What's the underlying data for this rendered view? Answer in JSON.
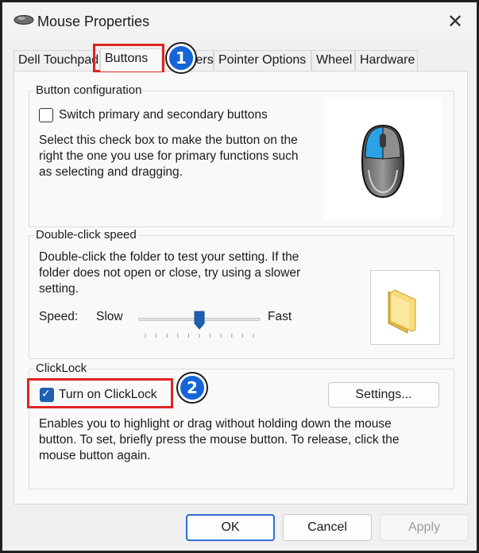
{
  "window": {
    "title": "Mouse Properties",
    "close_label": "✕"
  },
  "tabs": [
    {
      "label": "Dell Touchpad",
      "active": false
    },
    {
      "label": "Buttons",
      "active": true
    },
    {
      "label": "Pointers",
      "active": false
    },
    {
      "label": "Pointer Options",
      "active": false
    },
    {
      "label": "Wheel",
      "active": false
    },
    {
      "label": "Hardware",
      "active": false
    }
  ],
  "button_config": {
    "heading": "Button configuration",
    "checkbox_label": "Switch primary and secondary buttons",
    "checked": false,
    "description_lines": [
      "Select this check box to make the button on the",
      "right the one you use for primary functions such",
      "as selecting and dragging."
    ]
  },
  "double_click": {
    "heading": "Double-click speed",
    "description_lines": [
      "Double-click the folder to test your setting. If the",
      "folder does not open or close, try using a slower",
      "setting."
    ],
    "speed_label": "Speed:",
    "slow_label": "Slow",
    "fast_label": "Fast",
    "speed_value": 0.5
  },
  "clicklock": {
    "heading": "ClickLock",
    "checkbox_label": "Turn on ClickLock",
    "checked": true,
    "settings_button": "Settings...",
    "description_lines": [
      "Enables you to highlight or drag without holding down the mouse",
      "button. To set, briefly press the mouse button. To release, click the",
      "mouse button again."
    ]
  },
  "footer": {
    "ok": "OK",
    "cancel": "Cancel",
    "apply": "Apply"
  },
  "annotations": {
    "badge_1": "1",
    "badge_2": "2"
  },
  "colors": {
    "accent": "#1f5fb3",
    "highlight": "#e02424",
    "badge": "#1565d8"
  }
}
